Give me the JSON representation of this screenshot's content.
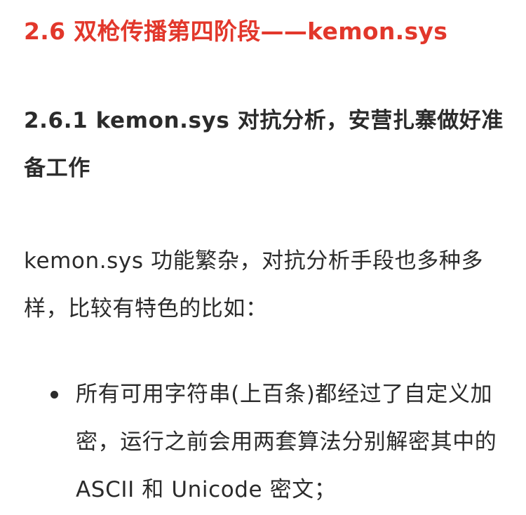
{
  "section": {
    "heading": "2.6 双枪传播第四阶段——kemon.sys"
  },
  "subsection": {
    "heading": "2.6.1 kemon.sys 对抗分析，安营扎寨做好准备工作"
  },
  "intro": {
    "text": "kemon.sys 功能繁杂，对抗分析手段也多种多样，比较有特色的比如："
  },
  "bullets": [
    {
      "text": "所有可用字符串(上百条)都经过了自定义加密，运行之前会用两套算法分别解密其中的 ASCII 和 Unicode 密文；"
    }
  ]
}
